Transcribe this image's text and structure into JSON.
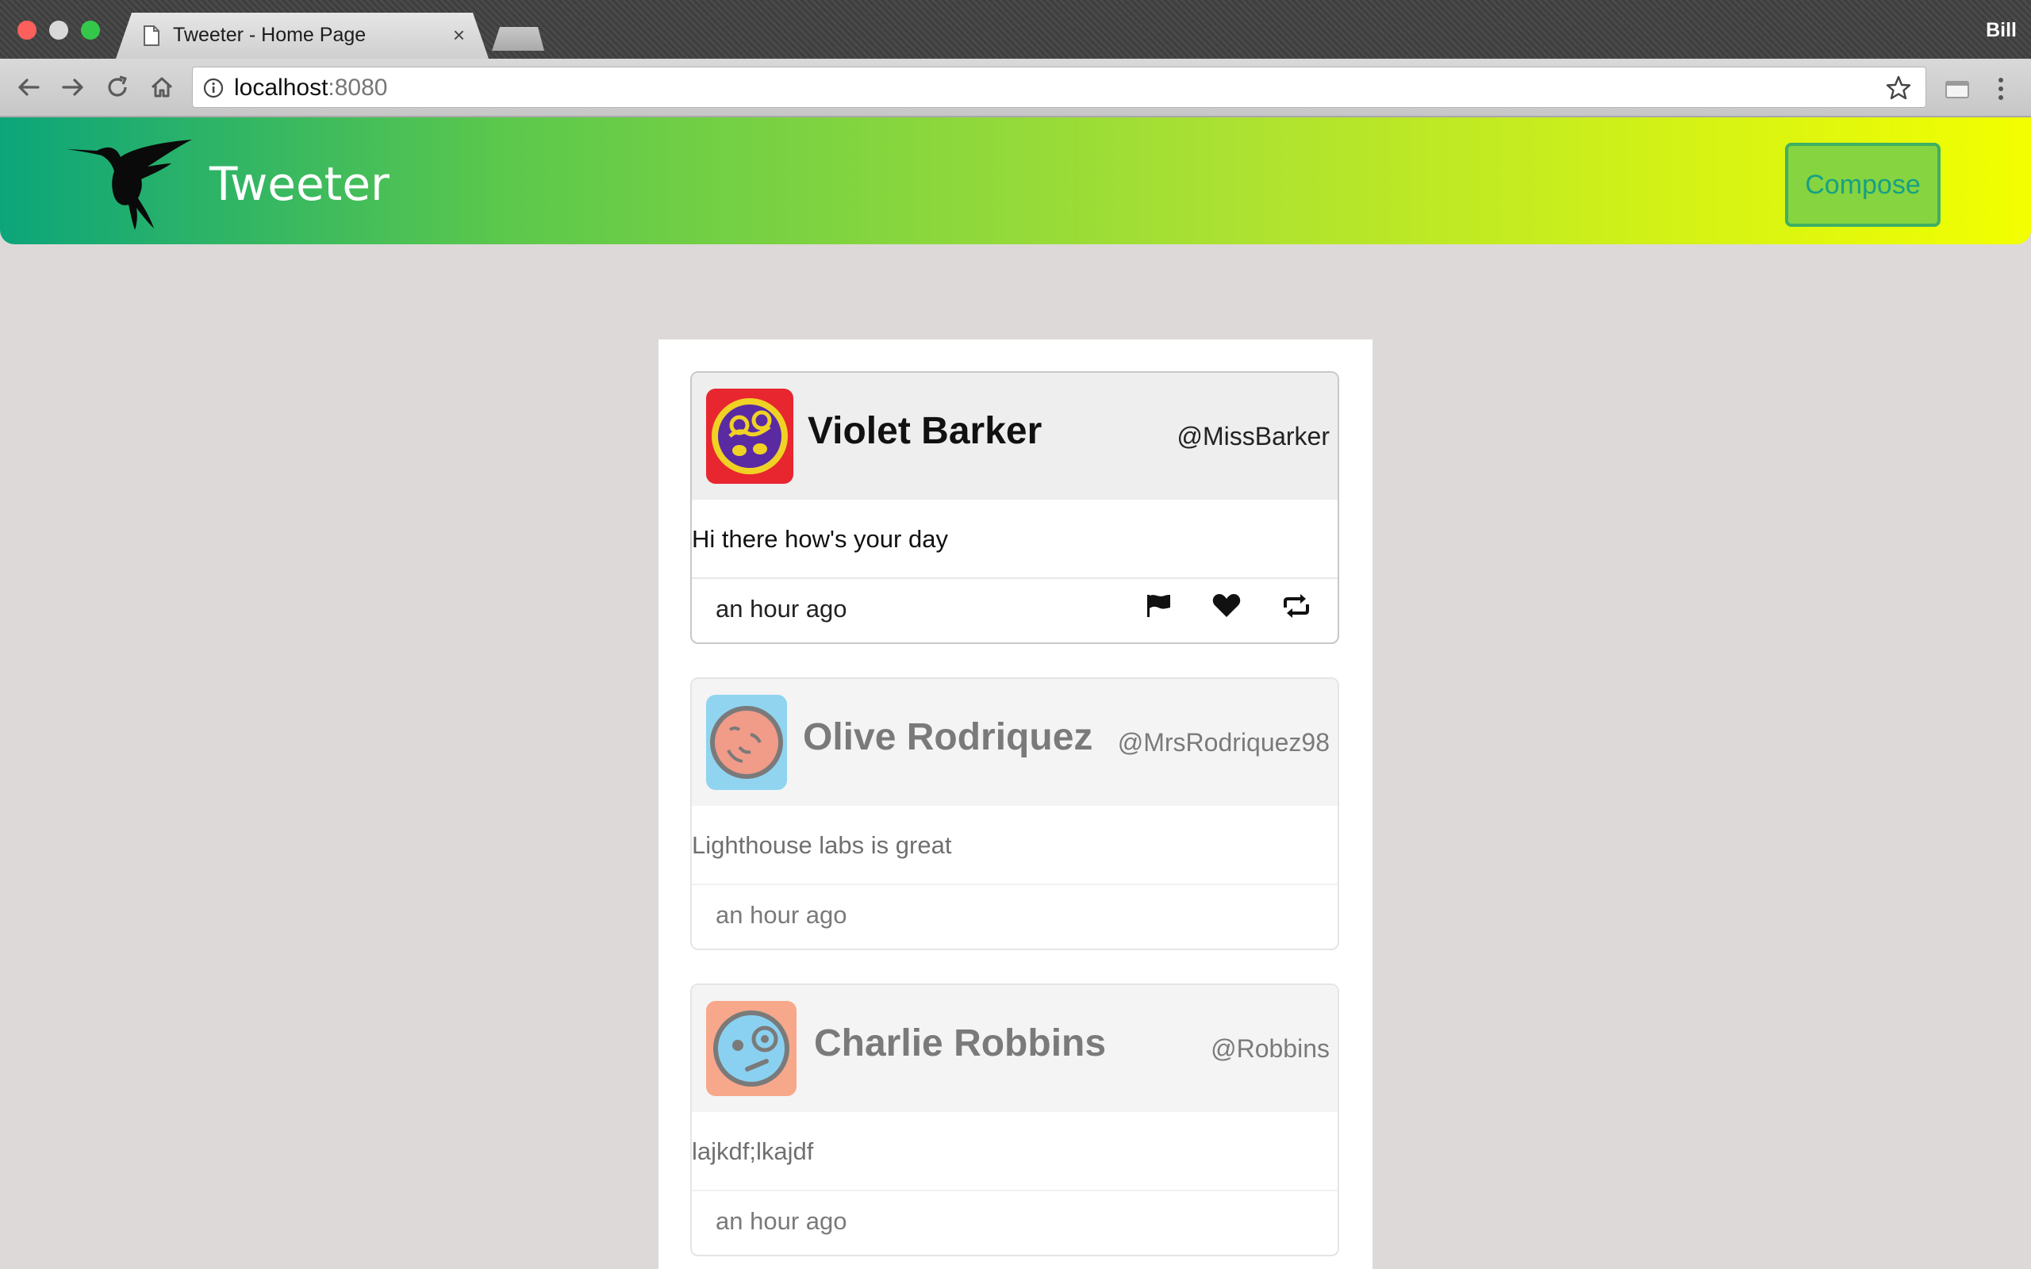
{
  "browser": {
    "tab_title": "Tweeter - Home Page",
    "tab_close": "×",
    "profile_name": "Bill",
    "url_host": "localhost",
    "url_port": ":8080"
  },
  "header": {
    "title": "Tweeter",
    "compose_label": "Compose"
  },
  "colors": {
    "header_gradient_start": "#0ca57a",
    "header_gradient_end": "#f3ff00",
    "compose_bg": "#86d440",
    "compose_text": "#17a085",
    "page_bg": "#ddd9d8"
  },
  "tweets": [
    {
      "name": "Violet Barker",
      "handle": "@MissBarker",
      "text": "Hi there how's your day",
      "time": "an hour ago",
      "avatar_color": "#e8262f",
      "icons": [
        "flag-icon",
        "heart-icon",
        "retweet-icon"
      ]
    },
    {
      "name": "Olive Rodriquez",
      "handle": "@MrsRodriquez98",
      "text": "Lighthouse labs is great",
      "time": "an hour ago",
      "avatar_color": "#47b8e6"
    },
    {
      "name": "Charlie Robbins",
      "handle": "@Robbins",
      "text": "lajkdf;lkajdf",
      "time": "an hour ago",
      "avatar_color": "#f2703f"
    }
  ]
}
